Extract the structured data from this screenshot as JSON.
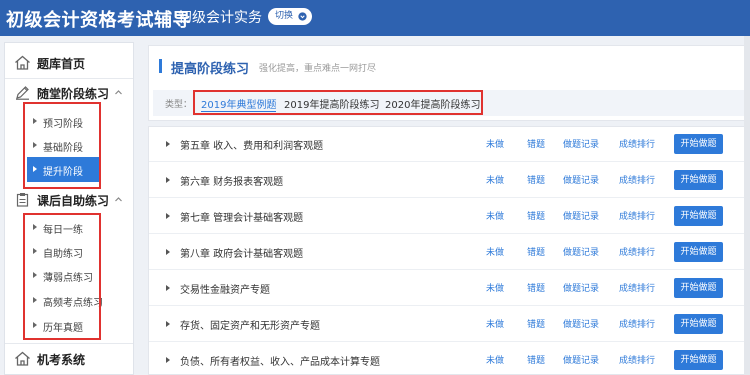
{
  "header": {
    "app_title": "初级会计资格考试辅导",
    "subject": "初级会计实务",
    "switch_label": "切换"
  },
  "sidebar": {
    "home": "题库首页",
    "groups": [
      {
        "title": "随堂阶段练习",
        "items": [
          "预习阶段",
          "基础阶段",
          "提升阶段"
        ]
      },
      {
        "title": "课后自助练习",
        "items": [
          "每日一练",
          "自助练习",
          "薄弱点练习",
          "高频考点练习",
          "历年真题"
        ]
      }
    ],
    "bottom": "机考系统",
    "active_item": "提升阶段"
  },
  "main": {
    "title": "提高阶段练习",
    "subtitle": "强化提高，重点难点一网打尽",
    "filter_label": "类型：",
    "filter_tabs": [
      "2019年典型例题",
      "2019年提高阶段练习",
      "2020年提高阶段练习"
    ],
    "active_tab": "2019年典型例题",
    "rows": [
      {
        "title": "第五章 收入、费用和利润客观题"
      },
      {
        "title": "第六章 财务报表客观题"
      },
      {
        "title": "第七章 管理会计基础客观题"
      },
      {
        "title": "第八章 政府会计基础客观题"
      },
      {
        "title": "交易性金融资产专题"
      },
      {
        "title": "存货、固定资产和无形资产专题"
      },
      {
        "title": "负债、所有者权益、收入、产品成本计算专题"
      }
    ],
    "row_links": {
      "undone": "未做",
      "wrong": "错题",
      "record": "做题记录",
      "rank": "成绩排行",
      "start": "开始做题"
    }
  },
  "colors": {
    "header_bg": "#2e62b0",
    "accent": "#2e7ad9",
    "highlight_box": "#e0322f"
  },
  "icons": [
    "chevron-down-icon",
    "home-icon",
    "pencil-icon",
    "clipboard-icon"
  ]
}
